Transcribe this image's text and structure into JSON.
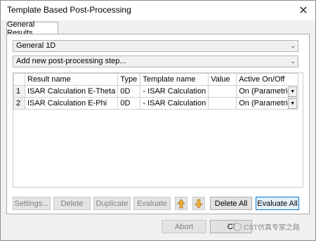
{
  "window": {
    "title": "Template Based Post-Processing",
    "close_glyph": "✕"
  },
  "tabs": [
    {
      "label": "General Results"
    }
  ],
  "filter_combo": {
    "value": "General 1D"
  },
  "add_combo": {
    "value": "Add new post-processing step..."
  },
  "grid": {
    "headers": [
      "Result name",
      "Type",
      "Template name",
      "Value",
      "Active On/Off"
    ],
    "rows": [
      {
        "num": "1",
        "name": "ISAR Calculation E-Theta",
        "type": "0D",
        "template": "- ISAR Calculation",
        "value": "",
        "active": "On (Parametric)"
      },
      {
        "num": "2",
        "name": "ISAR Calculation E-Phi",
        "type": "0D",
        "template": "- ISAR Calculation",
        "value": "",
        "active": "On (Parametric)"
      }
    ]
  },
  "buttons": {
    "settings": "Settings...",
    "delete": "Delete",
    "duplicate": "Duplicate",
    "evaluate": "Evaluate",
    "delete_all": "Delete All",
    "evaluate_all": "Evaluate All",
    "abort": "Abort",
    "close": "Cl"
  },
  "icons": {
    "up": "arrow-up-icon",
    "down": "arrow-down-icon",
    "arrow_color": "#f0b040"
  },
  "watermark": {
    "text": "CST仿真专家之路"
  }
}
